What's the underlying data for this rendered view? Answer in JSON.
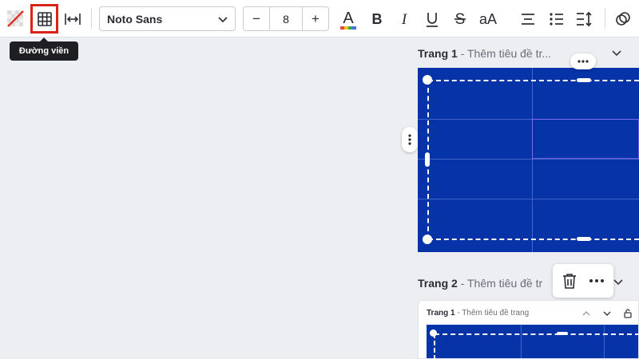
{
  "toolbar": {
    "font_family": "Noto Sans",
    "font_size": "8",
    "decrease_label": "−",
    "increase_label": "+",
    "case_label": "aA",
    "border_tooltip": "Đường viền",
    "text_color": "#1e1e2a"
  },
  "pages": [
    {
      "number": "Trang 1",
      "title_hint": "- Thêm tiêu đề tr..."
    },
    {
      "number": "Trang 2",
      "title_hint": "- Thêm tiêu đề tr"
    }
  ],
  "mini_page": {
    "number": "Trang 1",
    "title_hint": "- Thêm tiêu đề trang"
  },
  "colors": {
    "canvas_blue": "#0633a8",
    "highlight_red": "#d9221c",
    "tooltip_bg": "#1f1f23"
  }
}
